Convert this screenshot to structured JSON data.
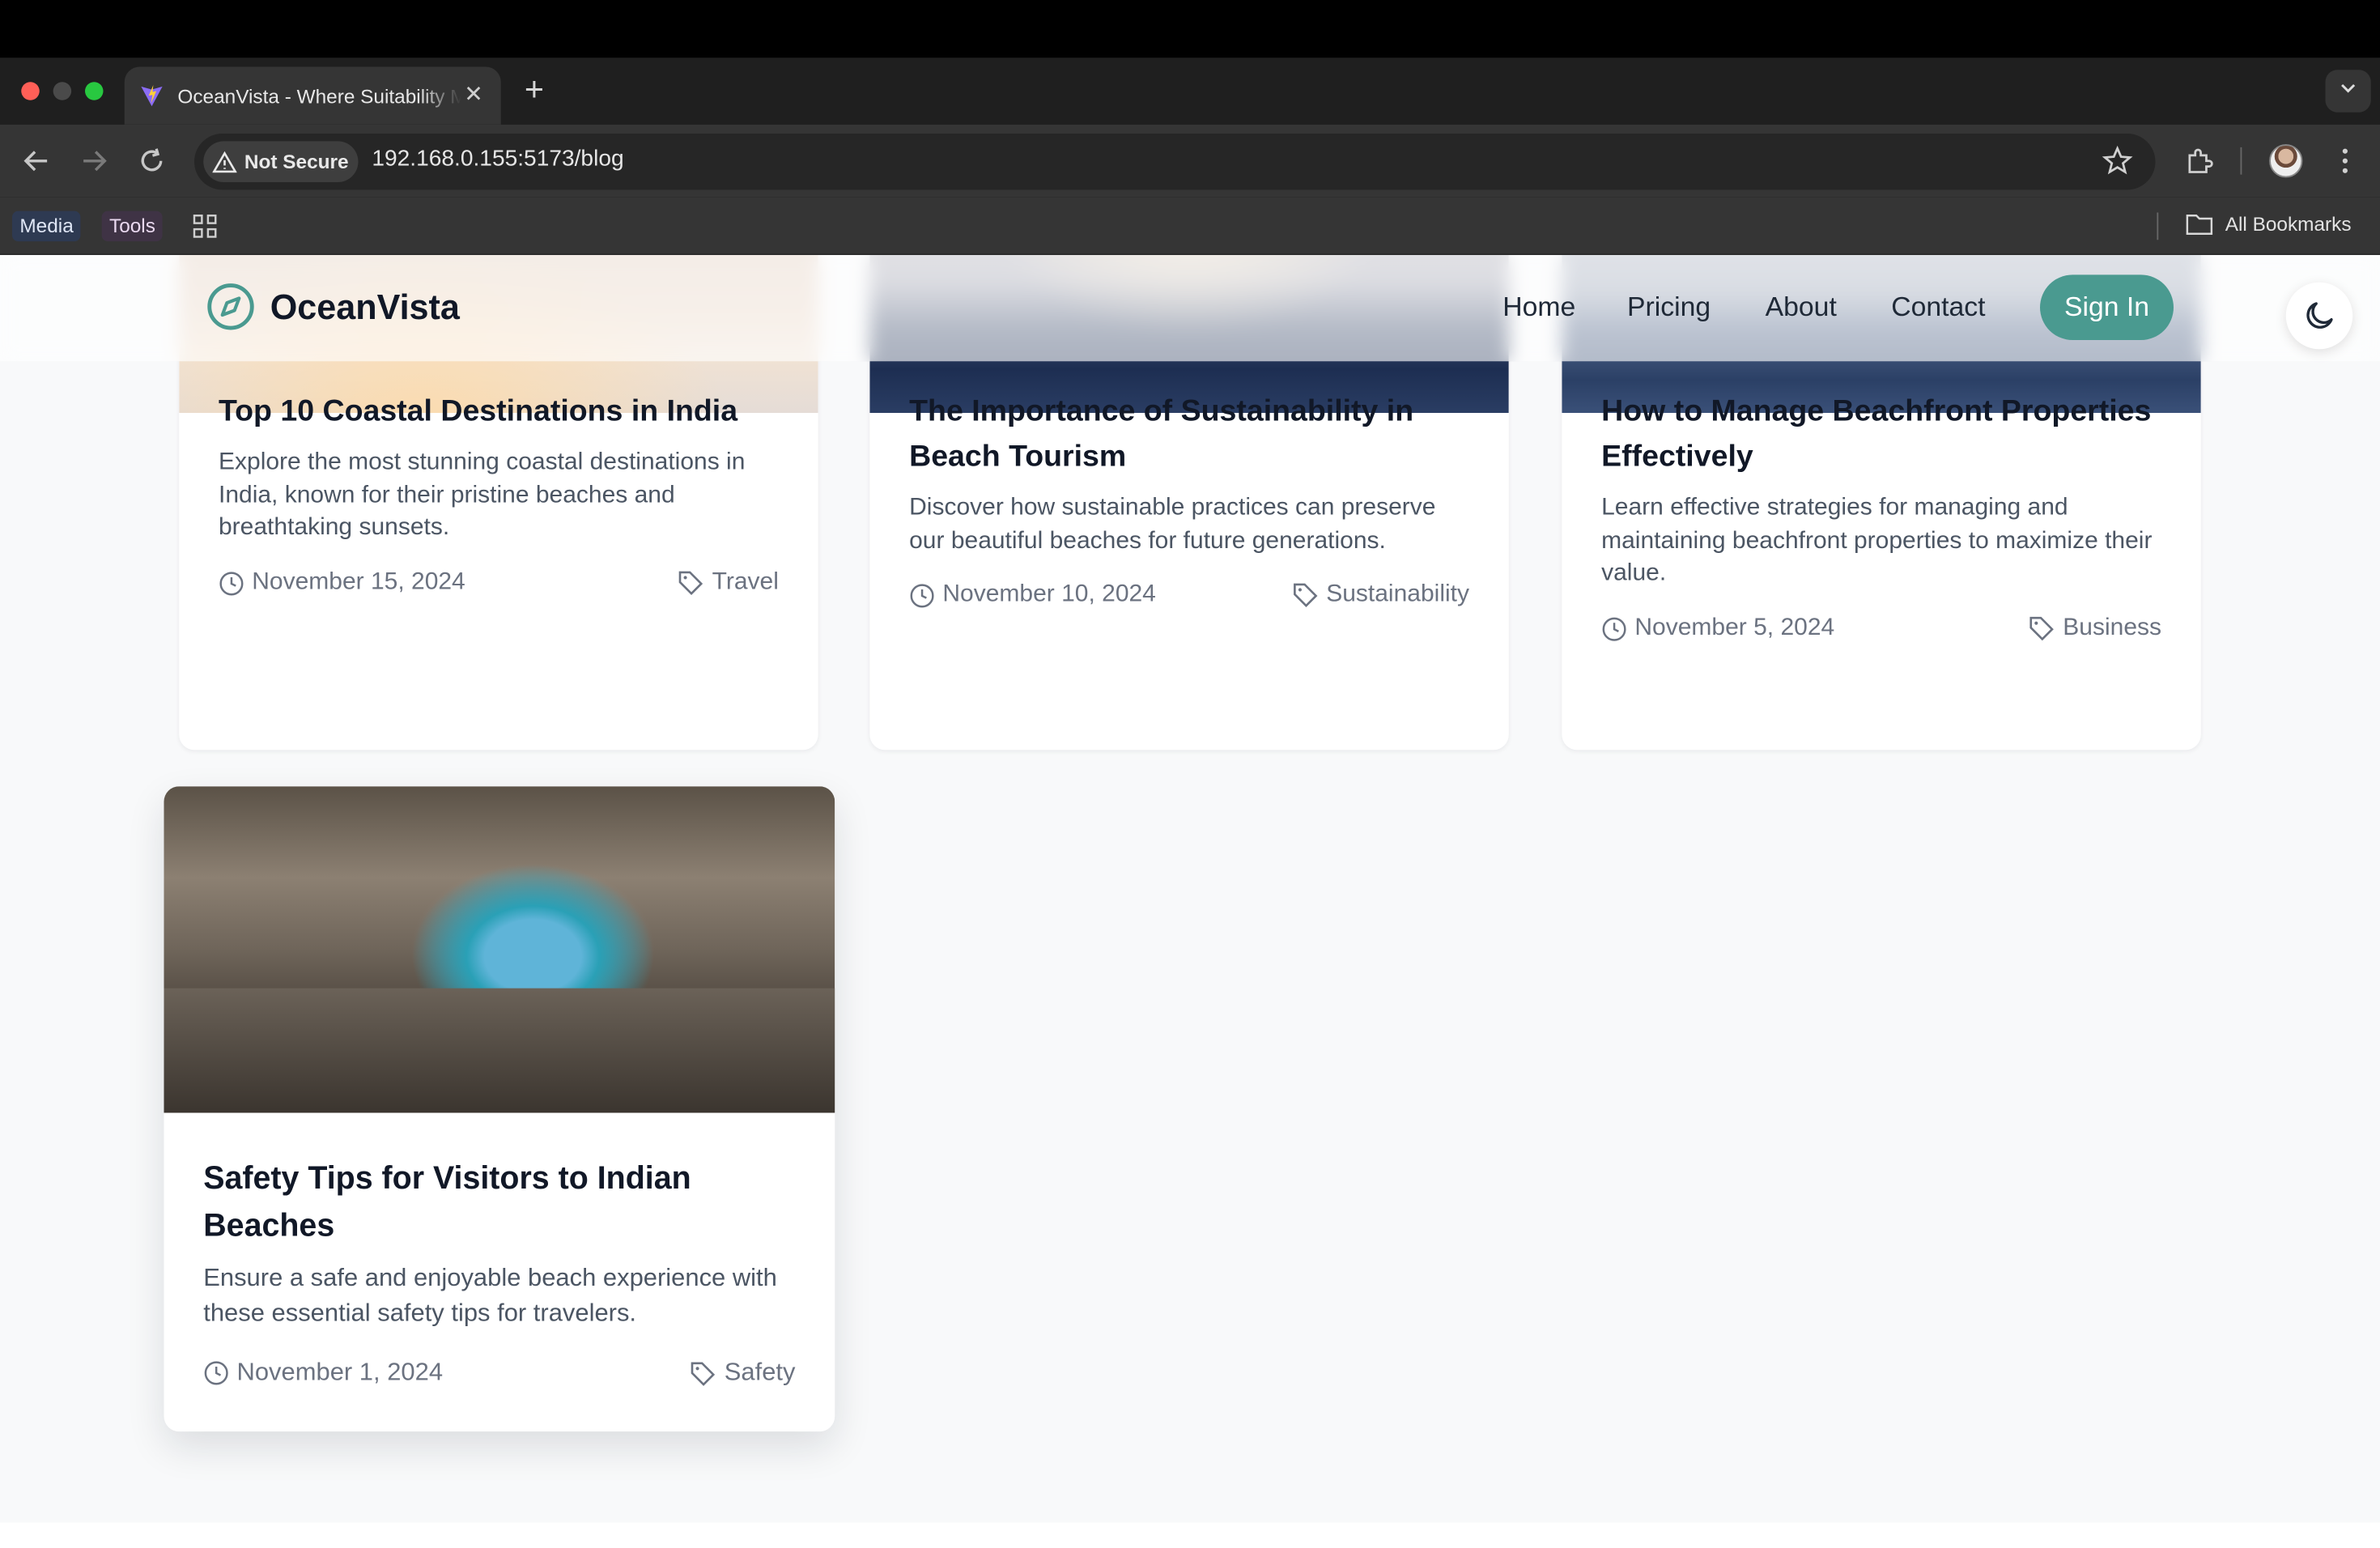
{
  "browser": {
    "tab_title": "OceanVista - Where Suitability Meets Serenity",
    "security_label": "Not Secure",
    "url": "192.168.0.155:5173/blog",
    "bookmarks": [
      "Media",
      "Tools"
    ],
    "all_bookmarks_label": "All Bookmarks"
  },
  "site": {
    "brand": "OceanVista",
    "nav": [
      "Home",
      "Pricing",
      "About",
      "Contact"
    ],
    "sign_in_label": "Sign In",
    "accent_color": "#4a9a90"
  },
  "posts": [
    {
      "title": "Top 10 Coastal Destinations in India",
      "excerpt": "Explore the most stunning coastal destinations in India, known for their pristine beaches and breathtaking sunsets.",
      "date": "November 15, 2024",
      "category": "Travel"
    },
    {
      "title": "The Importance of Sustainability in Beach Tourism",
      "excerpt": "Discover how sustainable practices can preserve our beautiful beaches for future generations.",
      "date": "November 10, 2024",
      "category": "Sustainability"
    },
    {
      "title": "How to Manage Beachfront Properties Effectively",
      "excerpt": "Learn effective strategies for managing and maintaining beachfront properties to maximize their value.",
      "date": "November 5, 2024",
      "category": "Business"
    },
    {
      "title": "Safety Tips for Visitors to Indian Beaches",
      "excerpt": "Ensure a safe and enjoyable beach experience with these essential safety tips for travelers.",
      "date": "November 1, 2024",
      "category": "Safety"
    }
  ]
}
